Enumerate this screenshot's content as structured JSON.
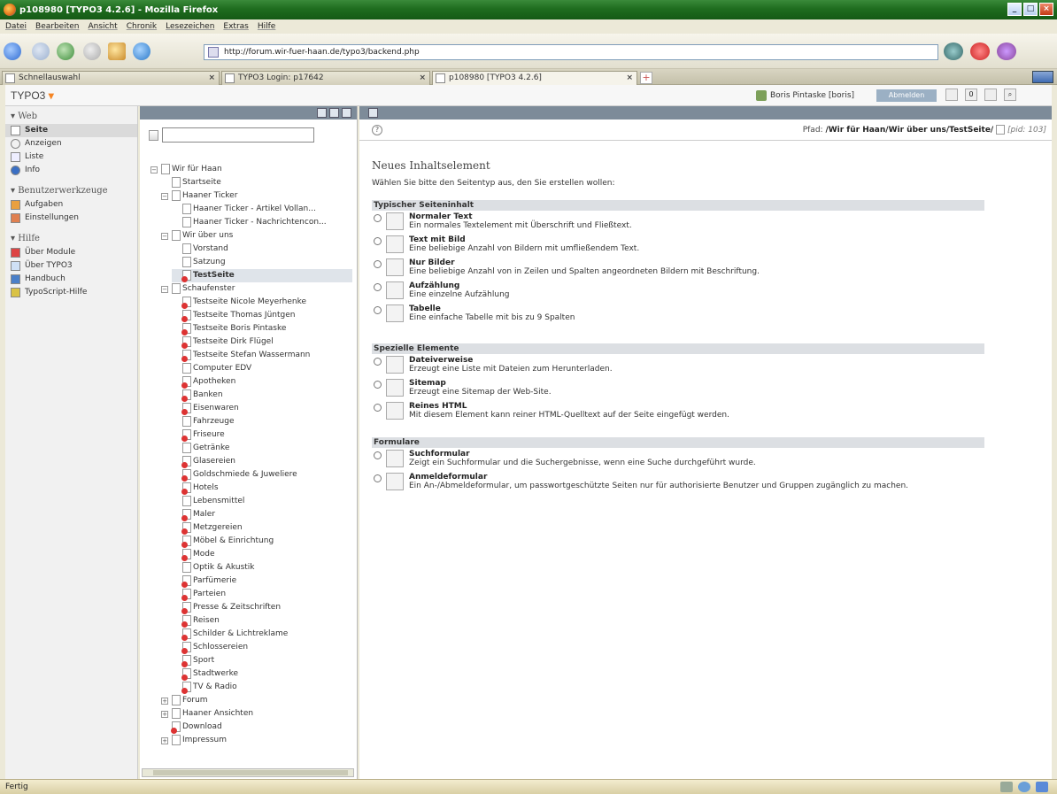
{
  "window": {
    "title": "p108980 [TYPO3 4.2.6] - Mozilla Firefox",
    "controls": [
      "_",
      "□",
      "×"
    ]
  },
  "menu": [
    "Datei",
    "Bearbeiten",
    "Ansicht",
    "Chronik",
    "Lesezeichen",
    "Extras",
    "Hilfe"
  ],
  "url": "http://forum.wir-fuer-haan.de/typo3/backend.php",
  "tabs": [
    {
      "label": "Schnellauswahl",
      "close": "×"
    },
    {
      "label": "TYPO3 Login: p17642",
      "close": "×"
    },
    {
      "label": "p108980 [TYPO3 4.2.6]",
      "close": "×"
    }
  ],
  "newtab": "+",
  "typo3": {
    "logo": "TYPO3",
    "user": "Boris Pintaske [boris]",
    "logout": "Abmelden",
    "top_icons": [
      "",
      "0",
      ""
    ]
  },
  "modules": [
    {
      "group": "▾ Web",
      "items": [
        {
          "label": "Seite",
          "active": true,
          "icon": "page-icon"
        },
        {
          "label": "Anzeigen",
          "icon": "magnifier-icon"
        },
        {
          "label": "Liste",
          "icon": "list-icon"
        },
        {
          "label": "Info",
          "icon": "info-icon"
        }
      ]
    },
    {
      "group": "▾ Benutzerwerkzeuge",
      "items": [
        {
          "label": "Aufgaben",
          "icon": "tasks-icon"
        },
        {
          "label": "Einstellungen",
          "icon": "settings-icon"
        }
      ]
    },
    {
      "group": "▾ Hilfe",
      "items": [
        {
          "label": "Über Module",
          "icon": "about-modules-icon"
        },
        {
          "label": "Über TYPO3",
          "icon": "about-typo3-icon"
        },
        {
          "label": "Handbuch",
          "icon": "manual-icon"
        },
        {
          "label": "TypoScript-Hilfe",
          "icon": "typoscript-help-icon"
        }
      ]
    }
  ],
  "tree": {
    "filter_value": "",
    "nodes": [
      {
        "label": "Wir für Haan",
        "level": 0,
        "exp": "−"
      },
      {
        "label": "Startseite",
        "level": 1
      },
      {
        "label": "Haaner Ticker",
        "level": 1,
        "exp": "−"
      },
      {
        "label": "Haaner Ticker - Artikel Vollan...",
        "level": 2
      },
      {
        "label": "Haaner Ticker - Nachrichtencon...",
        "level": 2
      },
      {
        "label": "Wir über uns",
        "level": 1,
        "exp": "−"
      },
      {
        "label": "Vorstand",
        "level": 2
      },
      {
        "label": "Satzung",
        "level": 2
      },
      {
        "label": "TestSeite",
        "level": 2,
        "red": true,
        "selected": true
      },
      {
        "label": "Schaufenster",
        "level": 1,
        "exp": "−"
      },
      {
        "label": "Testseite Nicole Meyerhenke",
        "level": 2,
        "red": true
      },
      {
        "label": "Testseite Thomas Jüntgen",
        "level": 2,
        "red": true
      },
      {
        "label": "Testseite Boris Pintaske",
        "level": 2,
        "red": true
      },
      {
        "label": "Testseite Dirk Flügel",
        "level": 2,
        "red": true
      },
      {
        "label": "Testseite Stefan Wassermann",
        "level": 2,
        "red": true
      },
      {
        "label": "Computer EDV",
        "level": 2
      },
      {
        "label": "Apotheken",
        "level": 2,
        "red": true
      },
      {
        "label": "Banken",
        "level": 2,
        "red": true
      },
      {
        "label": "Eisenwaren",
        "level": 2,
        "red": true
      },
      {
        "label": "Fahrzeuge",
        "level": 2
      },
      {
        "label": "Friseure",
        "level": 2,
        "red": true
      },
      {
        "label": "Getränke",
        "level": 2
      },
      {
        "label": "Glasereien",
        "level": 2,
        "red": true
      },
      {
        "label": "Goldschmiede & Juweliere",
        "level": 2,
        "red": true
      },
      {
        "label": "Hotels",
        "level": 2,
        "red": true
      },
      {
        "label": "Lebensmittel",
        "level": 2
      },
      {
        "label": "Maler",
        "level": 2,
        "red": true
      },
      {
        "label": "Metzgereien",
        "level": 2,
        "red": true
      },
      {
        "label": "Möbel & Einrichtung",
        "level": 2,
        "red": true
      },
      {
        "label": "Mode",
        "level": 2,
        "red": true
      },
      {
        "label": "Optik & Akustik",
        "level": 2
      },
      {
        "label": "Parfümerie",
        "level": 2,
        "red": true
      },
      {
        "label": "Parteien",
        "level": 2,
        "red": true
      },
      {
        "label": "Presse & Zeitschriften",
        "level": 2,
        "red": true
      },
      {
        "label": "Reisen",
        "level": 2,
        "red": true
      },
      {
        "label": "Schilder & Lichtreklame",
        "level": 2,
        "red": true
      },
      {
        "label": "Schlossereien",
        "level": 2,
        "red": true
      },
      {
        "label": "Sport",
        "level": 2,
        "red": true
      },
      {
        "label": "Stadtwerke",
        "level": 2,
        "red": true
      },
      {
        "label": "TV & Radio",
        "level": 2,
        "red": true
      },
      {
        "label": "Forum",
        "level": 1,
        "exp": "+"
      },
      {
        "label": "Haaner Ansichten",
        "level": 1,
        "exp": "+"
      },
      {
        "label": "Download",
        "level": 1,
        "red": true
      },
      {
        "label": "Impressum",
        "level": 1,
        "exp": "+"
      }
    ]
  },
  "content": {
    "help": "?",
    "path_label": "Pfad:",
    "path": "/Wir für Haan/Wir über uns/TestSeite/",
    "uid": "[pid: 103]",
    "title": "Neues Inhaltselement",
    "intro": "Wählen Sie bitte den Seitentyp aus, den Sie erstellen wollen:",
    "sections": [
      {
        "title": "Typischer Seiteninhalt",
        "items": [
          {
            "name": "Normaler Text",
            "desc": "Ein normales Textelement mit Überschrift und Fließtext.",
            "icon": "text-icon"
          },
          {
            "name": "Text mit Bild",
            "desc": "Eine beliebige Anzahl von Bildern mit umfließendem Text.",
            "icon": "text-image-icon"
          },
          {
            "name": "Nur Bilder",
            "desc": "Eine beliebige Anzahl von in Zeilen und Spalten angeordneten Bildern mit Beschriftung.",
            "icon": "images-icon"
          },
          {
            "name": "Aufzählung",
            "desc": "Eine einzelne Aufzählung",
            "icon": "bullet-list-icon"
          },
          {
            "name": "Tabelle",
            "desc": "Eine einfache Tabelle mit bis zu 9 Spalten",
            "icon": "table-icon"
          }
        ]
      },
      {
        "title": "Spezielle Elemente",
        "items": [
          {
            "name": "Dateiverweise",
            "desc": "Erzeugt eine Liste mit Dateien zum Herunterladen.",
            "icon": "file-links-icon"
          },
          {
            "name": "Sitemap",
            "desc": "Erzeugt eine Sitemap der Web-Site.",
            "icon": "sitemap-icon"
          },
          {
            "name": "Reines HTML",
            "desc": "Mit diesem Element kann reiner HTML-Quelltext auf der Seite eingefügt werden.",
            "icon": "html-icon"
          }
        ]
      },
      {
        "title": "Formulare",
        "items": [
          {
            "name": "Suchformular",
            "desc": "Zeigt ein Suchformular und die Suchergebnisse, wenn eine Suche durchgeführt wurde.",
            "icon": "search-form-icon"
          },
          {
            "name": "Anmeldeformular",
            "desc": "Ein An-/Abmeldeformular, um passwortgeschützte Seiten nur für authorisierte Benutzer und Gruppen zugänglich zu machen.",
            "icon": "login-form-icon"
          }
        ]
      }
    ]
  },
  "status": "Fertig",
  "colors": {
    "titlebar": "#1f6d1f",
    "accent": "#f58524",
    "panel_header": "#7d8b99",
    "section_bg": "#dcdfe3"
  }
}
